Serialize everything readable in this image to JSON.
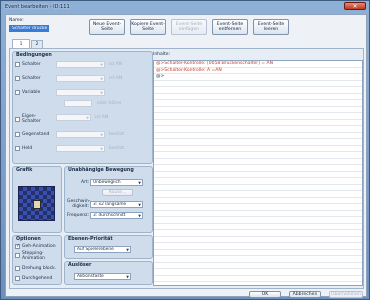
{
  "window": {
    "title": "Event bearbeiten - ID:111",
    "close_glyph": "✕"
  },
  "name": {
    "label": "Name:",
    "value": "Schalter drücke"
  },
  "toolbar": {
    "new_page": "Neue Event-Seite",
    "copy_page": "Kopiere Event-Seite",
    "paste_page": "Event-Seite einfügen",
    "delete_page": "Event-Seite entfernen",
    "clear_page": "Event-Seite leeren"
  },
  "tabs": [
    "1",
    "2"
  ],
  "conditions": {
    "title": "Bedingungen",
    "switch1": "Schalter",
    "switch2": "Schalter",
    "variable": "Variable",
    "self_switch": "Eigen-Schalter",
    "item": "Gegenstand",
    "hero": "Held",
    "is_on1": "ist AN",
    "is_on2": "ist AN",
    "is_on3": "ist AN",
    "or_above": "oder höher",
    "owned1": "besitzt",
    "owned2": "besitzt"
  },
  "graphic": {
    "title": "Grafik"
  },
  "movement": {
    "title": "Unabhängige Bewegung",
    "type_label": "Art:",
    "type_value": "Unbeweglich",
    "route_button": "Route...",
    "speed_label": "Geschwin-digkeit:",
    "speed_value": "3: x2 langsame",
    "freq_label": "Frequenz:",
    "freq_value": "3: durchschnitt"
  },
  "options": {
    "title": "Optionen",
    "walk_anim": "Geh-Animation",
    "step_anim": "Stepping-Animation",
    "dir_fix": "Drehung block.",
    "through": "Durchgehend"
  },
  "priority": {
    "title": "Ebenen-Priorität",
    "value": "Auf Spielerebene"
  },
  "trigger": {
    "title": "Auslöser",
    "value": "Aktionstaste"
  },
  "contents": {
    "label": "Inhalte:",
    "lines": [
      "@>Schalter-Kontrolle: [0058:Brückenschalter] = AN",
      "@>Schalter-Kontrolle: A =AN",
      "@>"
    ]
  },
  "footer": {
    "ok": "OK",
    "cancel": "Abbrechen",
    "apply": "Übernehmen"
  }
}
